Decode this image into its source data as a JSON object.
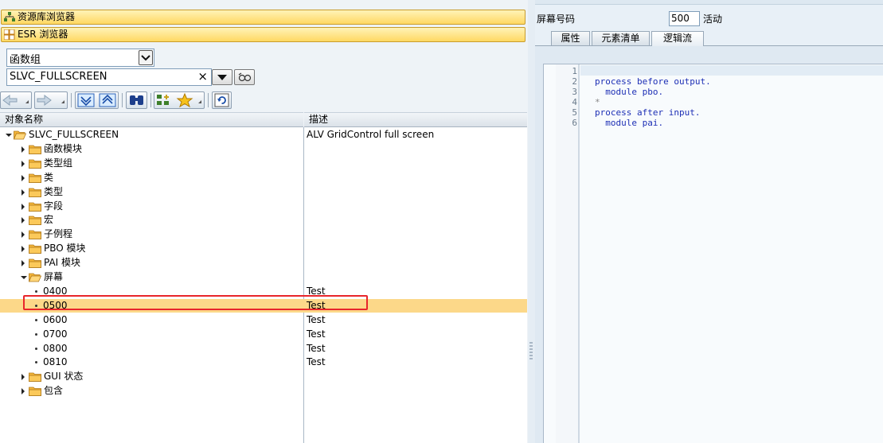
{
  "left_panel": {
    "repo_browser": "资源库浏览器",
    "esr_browser": "ESR 浏览器",
    "object_type": "函数组",
    "object_name": "SLVC_FULLSCREEN",
    "clear_symbol": "×",
    "columns": {
      "name": "对象名称",
      "desc": "描述"
    },
    "tree": [
      {
        "label": "SLVC_FULLSCREEN",
        "desc": "ALV GridControl full screen",
        "level": 0,
        "kind": "folder",
        "state": "expanded"
      },
      {
        "label": "函数模块",
        "desc": "",
        "level": 1,
        "kind": "folder",
        "state": "collapsed"
      },
      {
        "label": "类型组",
        "desc": "",
        "level": 1,
        "kind": "folder",
        "state": "collapsed"
      },
      {
        "label": "类",
        "desc": "",
        "level": 1,
        "kind": "folder",
        "state": "collapsed"
      },
      {
        "label": "类型",
        "desc": "",
        "level": 1,
        "kind": "folder",
        "state": "collapsed"
      },
      {
        "label": "字段",
        "desc": "",
        "level": 1,
        "kind": "folder",
        "state": "collapsed"
      },
      {
        "label": "宏",
        "desc": "",
        "level": 1,
        "kind": "folder",
        "state": "collapsed"
      },
      {
        "label": "子例程",
        "desc": "",
        "level": 1,
        "kind": "folder",
        "state": "collapsed"
      },
      {
        "label": "PBO 模块",
        "desc": "",
        "level": 1,
        "kind": "folder",
        "state": "collapsed"
      },
      {
        "label": "PAI 模块",
        "desc": "",
        "level": 1,
        "kind": "folder",
        "state": "collapsed"
      },
      {
        "label": "屏幕",
        "desc": "",
        "level": 1,
        "kind": "folder",
        "state": "expanded"
      },
      {
        "label": "0400",
        "desc": "Test",
        "level": 2,
        "kind": "leaf"
      },
      {
        "label": "0500",
        "desc": "Test",
        "level": 2,
        "kind": "leaf",
        "selected": true
      },
      {
        "label": "0600",
        "desc": "Test",
        "level": 2,
        "kind": "leaf"
      },
      {
        "label": "0700",
        "desc": "Test",
        "level": 2,
        "kind": "leaf"
      },
      {
        "label": "0800",
        "desc": "Test",
        "level": 2,
        "kind": "leaf"
      },
      {
        "label": "0810",
        "desc": "Test",
        "level": 2,
        "kind": "leaf"
      },
      {
        "label": "GUI 状态",
        "desc": "",
        "level": 1,
        "kind": "folder",
        "state": "collapsed"
      },
      {
        "label": "包含",
        "desc": "",
        "level": 1,
        "kind": "folder",
        "state": "collapsed"
      }
    ]
  },
  "right_panel": {
    "screen_label": "屏幕号码",
    "screen_number": "500",
    "status": "活动",
    "tabs": [
      {
        "label": "属性",
        "active": false
      },
      {
        "label": "元素清单",
        "active": false
      },
      {
        "label": "逻辑流",
        "active": true
      }
    ],
    "code_lines": [
      {
        "n": "1",
        "text": ""
      },
      {
        "n": "2",
        "text": "process before output."
      },
      {
        "n": "3",
        "text": "  module pbo."
      },
      {
        "n": "4",
        "text": "*"
      },
      {
        "n": "5",
        "text": "process after input."
      },
      {
        "n": "6",
        "text": "  module pai."
      }
    ]
  },
  "colors": {
    "selection": "#fcd889",
    "highlight_box": "#e8262b",
    "folder": "#f4b63a",
    "code_keyword": "#1d2fb5"
  }
}
